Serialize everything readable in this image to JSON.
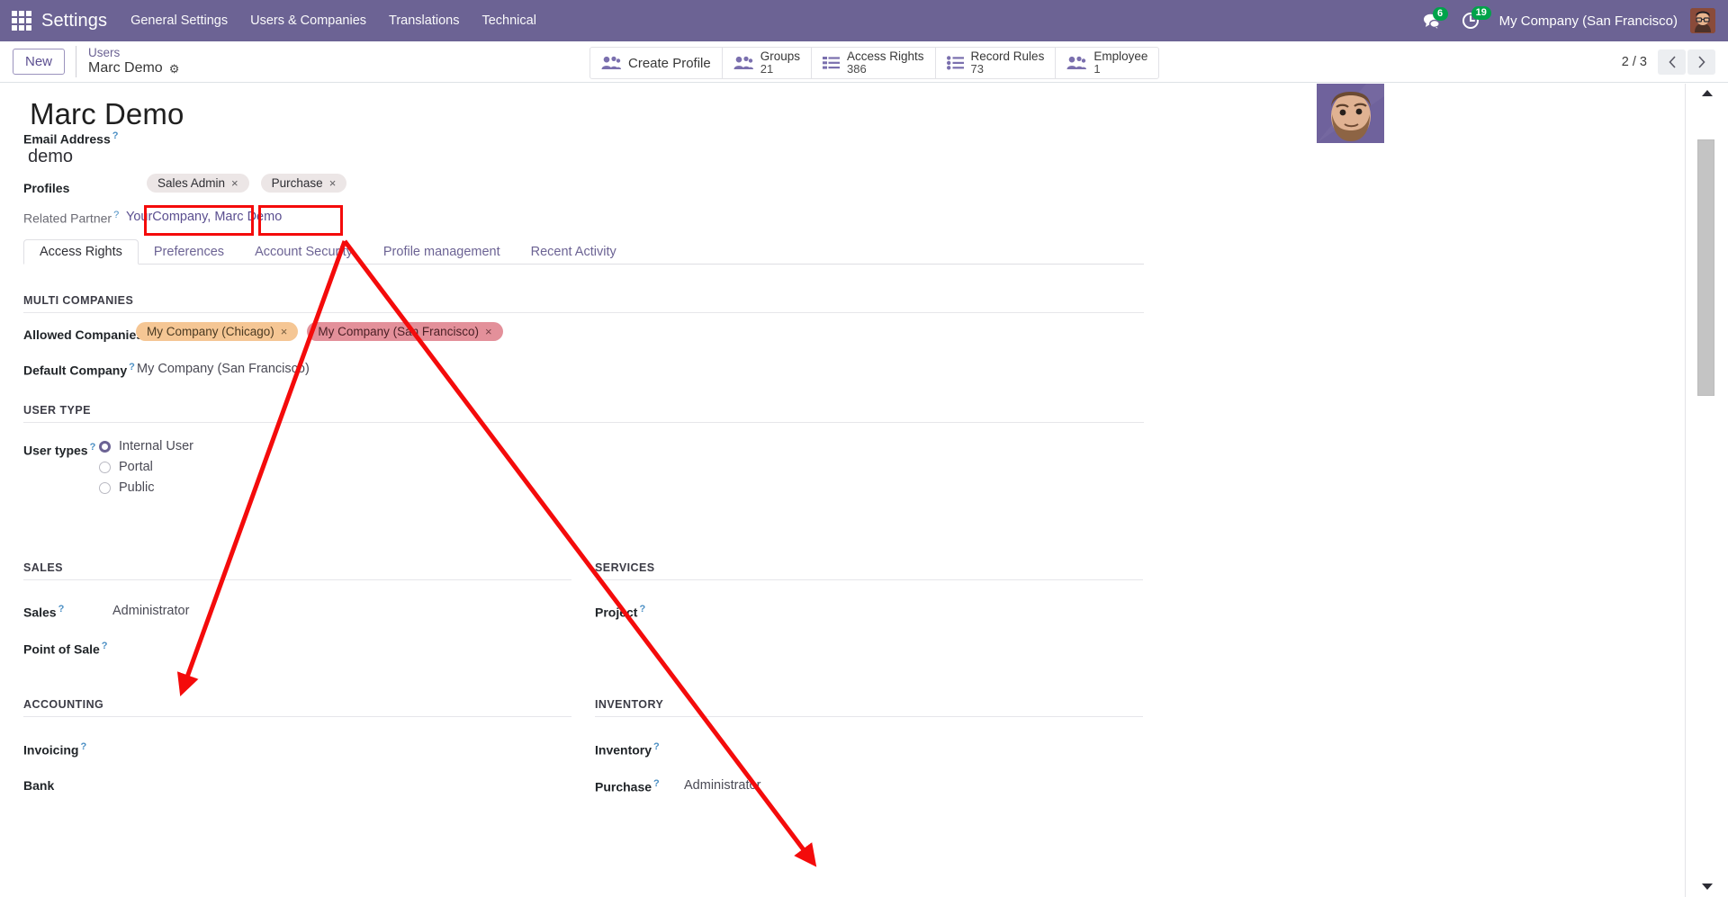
{
  "navbar": {
    "apps_icon": "apps-grid-icon",
    "brand": "Settings",
    "menu_items": [
      {
        "label": "General Settings"
      },
      {
        "label": "Users & Companies"
      },
      {
        "label": "Translations"
      },
      {
        "label": "Technical"
      }
    ],
    "messages_icon": "chat-bubble-icon",
    "messages_count": "6",
    "activity_icon": "clock-activity-icon",
    "activity_count": "19",
    "company": "My Company (San Francisco)",
    "avatar": "user-avatar",
    "bg_color": "#6c6394",
    "badge_color": "#00a34a"
  },
  "control_panel": {
    "new_label": "New",
    "breadcrumb_parent": "Users",
    "breadcrumb_current": "Marc Demo",
    "gear_icon": "gear-icon",
    "stat_buttons": [
      {
        "icon": "users-icon",
        "label": "Create Profile",
        "value": ""
      },
      {
        "icon": "users-icon",
        "label": "Groups",
        "value": "21"
      },
      {
        "icon": "list-lines-icon",
        "label": "Access Rights",
        "value": "386"
      },
      {
        "icon": "list-dots-icon",
        "label": "Record Rules",
        "value": "73"
      },
      {
        "icon": "users-icon",
        "label": "Employee",
        "value": "1"
      }
    ],
    "pager_count": "2 / 3",
    "pager_prev_icon": "chevron-left-icon",
    "pager_next_icon": "chevron-right-icon"
  },
  "form": {
    "record_title": "Marc Demo",
    "email_label": "Email Address",
    "email_value": "demo",
    "profiles_label": "Profiles",
    "profiles_tags": [
      {
        "label": "Sales Admin",
        "remove": "×"
      },
      {
        "label": "Purchase",
        "remove": "×"
      }
    ],
    "related_partner_label": "Related Partner",
    "related_partner_value": "YourCompany, Marc Demo",
    "help_marker": "?"
  },
  "tabs": [
    {
      "label": "Access Rights",
      "active": true
    },
    {
      "label": "Preferences",
      "active": false
    },
    {
      "label": "Account Security",
      "active": false
    },
    {
      "label": "Profile management",
      "active": false
    },
    {
      "label": "Recent Activity",
      "active": false
    }
  ],
  "sections": {
    "multi_companies": {
      "title": "MULTI COMPANIES",
      "allowed_companies_label": "Allowed Companies",
      "allowed_companies_tags": [
        {
          "label": "My Company (Chicago)",
          "remove": "×",
          "color": "#f5c694"
        },
        {
          "label": "My Company (San Francisco)",
          "remove": "×",
          "color": "#e3909a"
        }
      ],
      "default_company_label": "Default Company",
      "default_company_value": "My Company (San Francisco)"
    },
    "user_type": {
      "title": "USER TYPE",
      "user_types_label": "User types",
      "options": [
        {
          "label": "Internal User",
          "checked": true
        },
        {
          "label": "Portal",
          "checked": false
        },
        {
          "label": "Public",
          "checked": false
        }
      ]
    },
    "sales": {
      "title": "SALES",
      "rows": [
        {
          "label": "Sales",
          "value": "Administrator",
          "help": true
        },
        {
          "label": "Point of Sale",
          "value": "",
          "help": true
        }
      ]
    },
    "services": {
      "title": "SERVICES",
      "rows": [
        {
          "label": "Project",
          "value": "",
          "help": true
        }
      ]
    },
    "accounting": {
      "title": "ACCOUNTING",
      "rows": [
        {
          "label": "Invoicing",
          "value": "",
          "help": true
        },
        {
          "label": "Bank",
          "value": "",
          "help": false
        }
      ]
    },
    "inventory": {
      "title": "INVENTORY",
      "rows": [
        {
          "label": "Inventory",
          "value": "",
          "help": true
        },
        {
          "label": "Purchase",
          "value": "Administrator",
          "help": true
        }
      ]
    }
  },
  "scrollbar": {
    "up_arrow_icon": "triangle-up-icon",
    "down_arrow_icon": "triangle-down-icon",
    "thumb": "scroll-thumb"
  },
  "annotations": {
    "color": "#f40b0b",
    "boxes": [
      {
        "name": "highlight-sales-admin-tag"
      },
      {
        "name": "highlight-purchase-tag"
      }
    ],
    "arrows": [
      {
        "name": "arrow-to-sales-administrator"
      },
      {
        "name": "arrow-to-purchase-administrator"
      }
    ]
  }
}
